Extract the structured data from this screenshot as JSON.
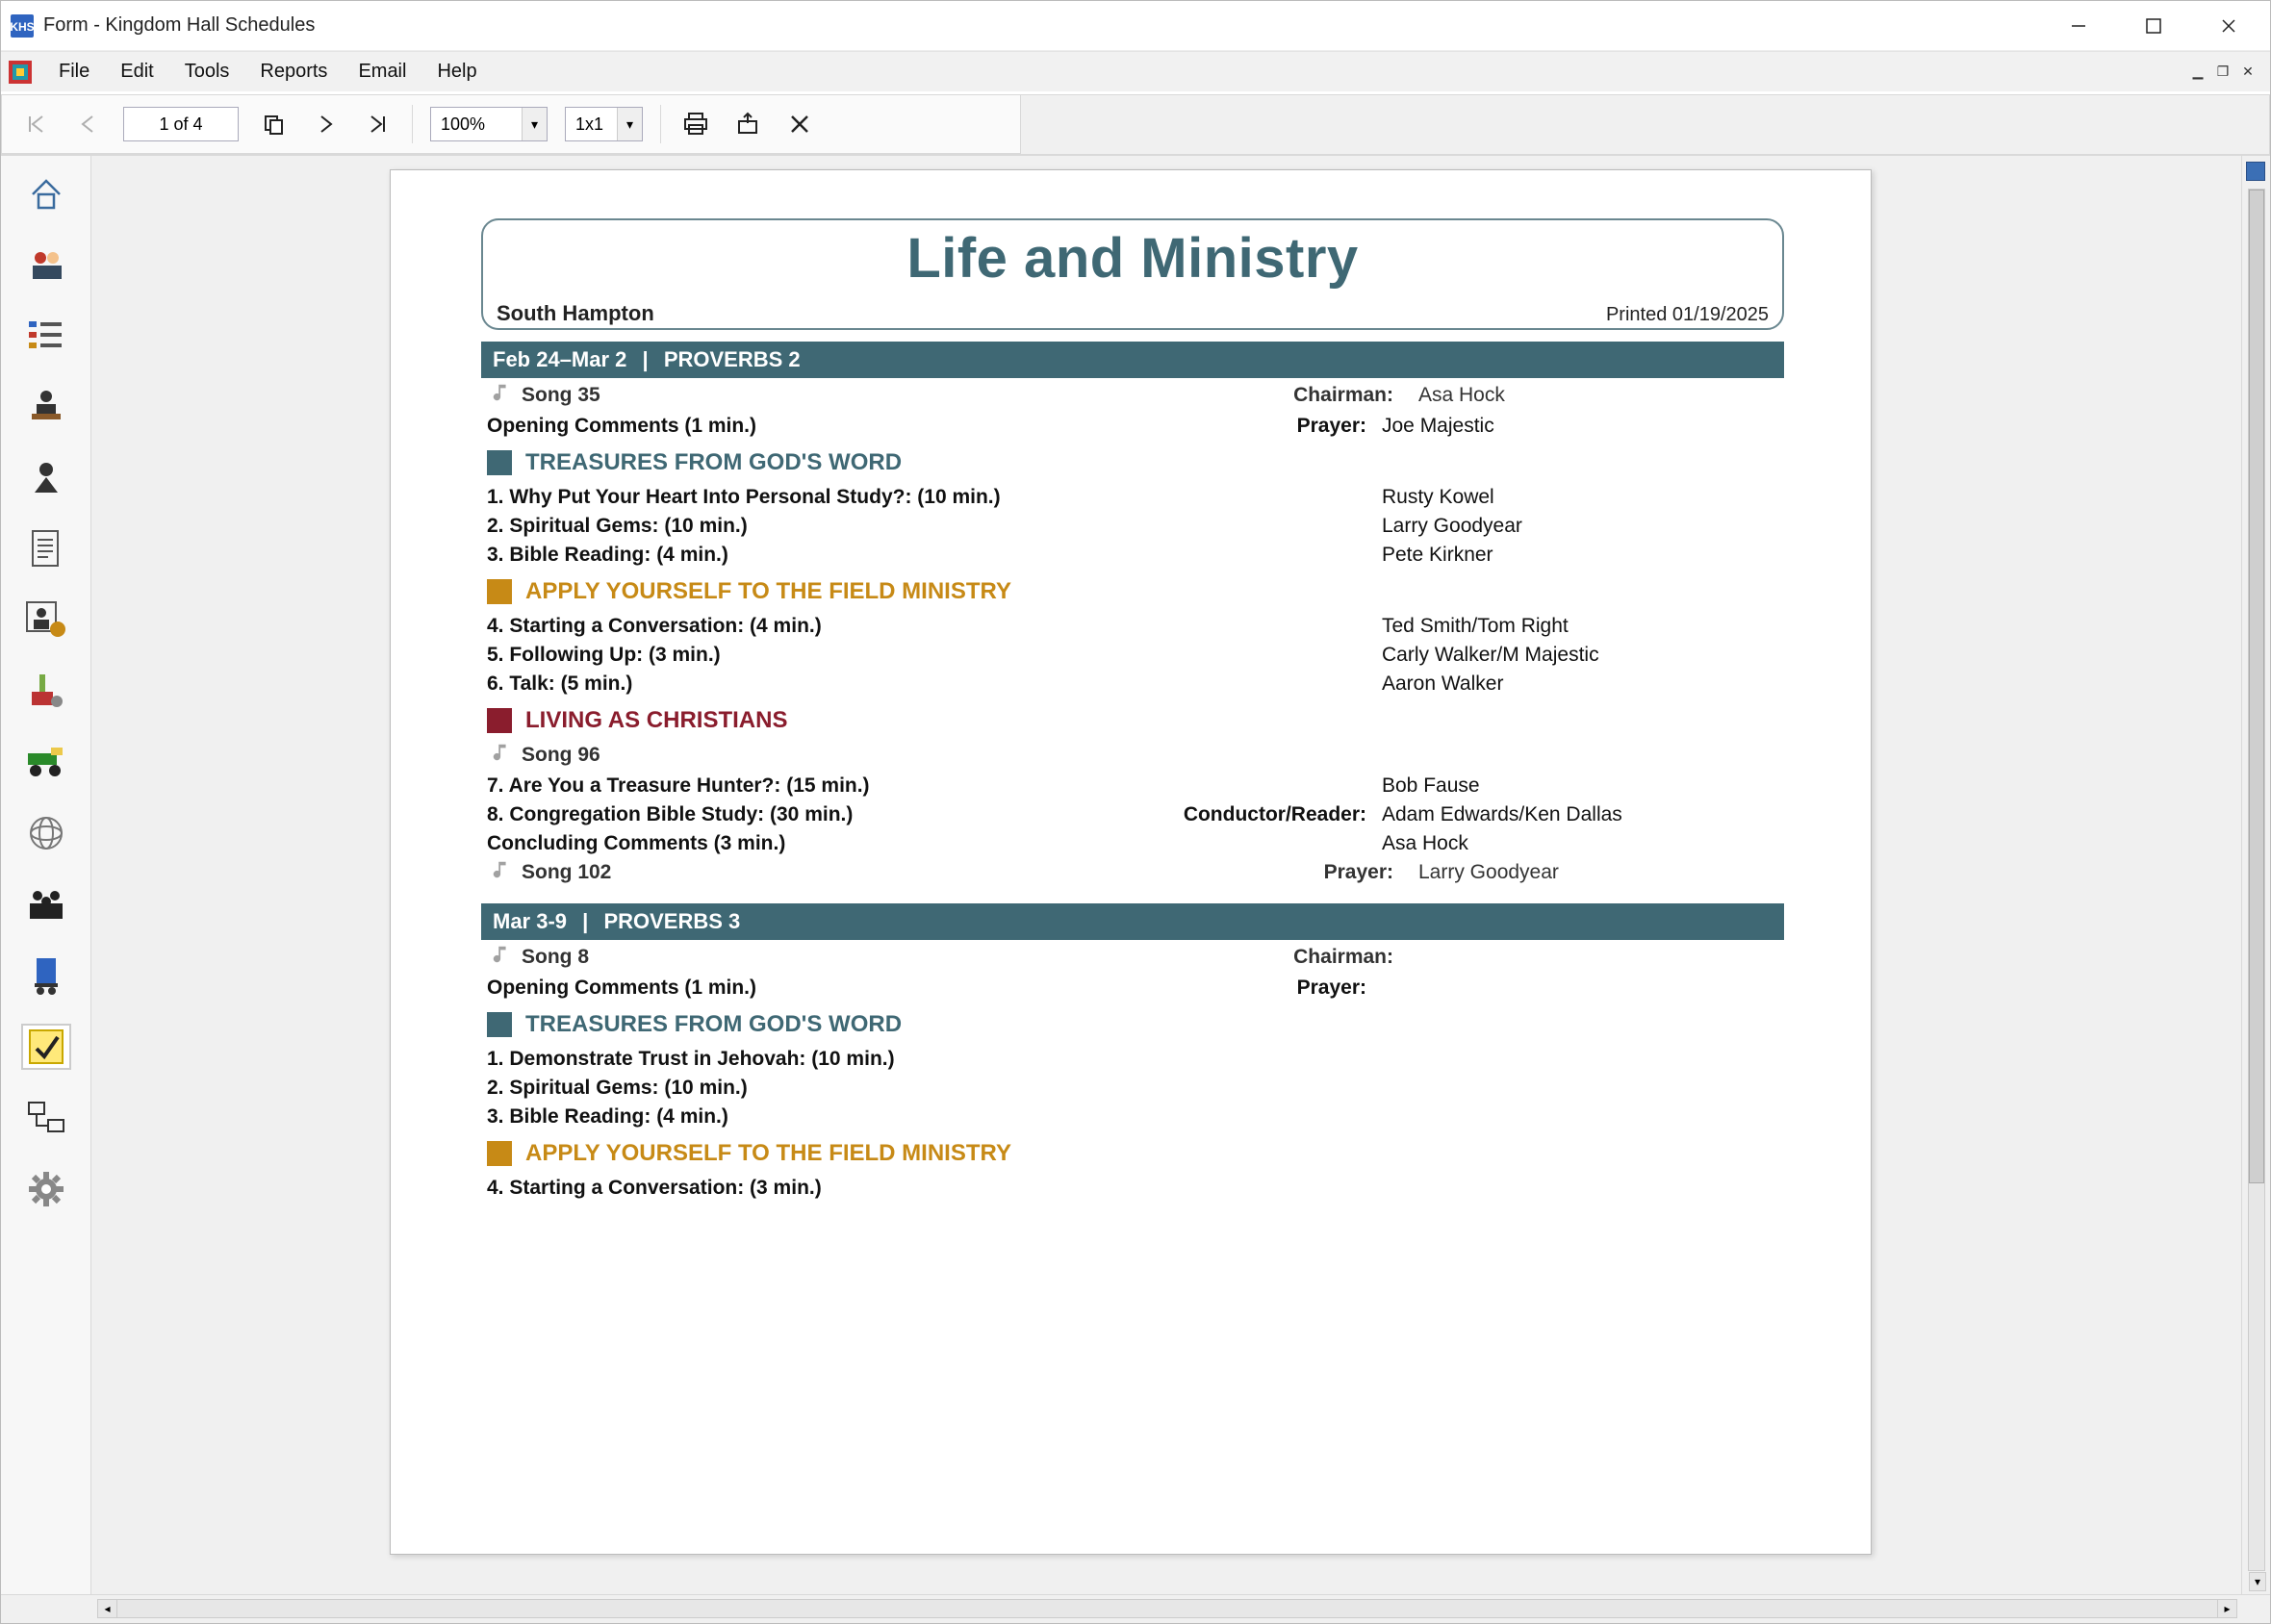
{
  "window": {
    "title": "Form - Kingdom Hall Schedules"
  },
  "menus": [
    "File",
    "Edit",
    "Tools",
    "Reports",
    "Email",
    "Help"
  ],
  "toolbar": {
    "page_display": "1 of 4",
    "zoom": "100%",
    "layout": "1x1"
  },
  "document": {
    "title": "Life and Ministry",
    "congregation": "South Hampton",
    "printed": "Printed 01/19/2025",
    "weeks": [
      {
        "dates": "Feb 24–Mar 2",
        "study": "PROVERBS 2",
        "open_song": "Song 35",
        "chairman_label": "Chairman:",
        "chairman": "Asa Hock",
        "opening_label": "Opening Comments (1 min.)",
        "prayer_label": "Prayer:",
        "prayer": "Joe Majestic",
        "treasures_head": "TREASURES FROM GOD'S WORD",
        "treasures": [
          {
            "t": "1. Why Put Your Heart Into Personal Study?: (10 min.)",
            "p": "Rusty Kowel"
          },
          {
            "t": "2. Spiritual Gems: (10 min.)",
            "p": "Larry Goodyear"
          },
          {
            "t": "3. Bible Reading: (4 min.)",
            "p": "Pete Kirkner"
          }
        ],
        "apply_head": "APPLY YOURSELF TO THE FIELD MINISTRY",
        "apply": [
          {
            "t": "4. Starting a Conversation: (4 min.)",
            "p": "Ted Smith/Tom Right"
          },
          {
            "t": "5. Following Up: (3 min.)",
            "p": "Carly Walker/M Majestic"
          },
          {
            "t": "6. Talk: (5 min.)",
            "p": "Aaron Walker"
          }
        ],
        "living_head": "LIVING AS CHRISTIANS",
        "mid_song": "Song 96",
        "living": [
          {
            "t": "7. Are You a Treasure Hunter?: (15 min.)",
            "l": "",
            "p": "Bob Fause"
          },
          {
            "t": "8. Congregation Bible Study: (30 min.)",
            "l": "Conductor/Reader:",
            "p": "Adam Edwards/Ken Dallas"
          }
        ],
        "concluding_label": "Concluding Comments (3 min.)",
        "concluding_person": "Asa Hock",
        "close_song": "Song 102",
        "close_prayer_label": "Prayer:",
        "close_prayer": "Larry Goodyear"
      },
      {
        "dates": "Mar 3-9",
        "study": "PROVERBS 3",
        "open_song": "Song 8",
        "chairman_label": "Chairman:",
        "chairman": "",
        "opening_label": "Opening Comments (1 min.)",
        "prayer_label": "Prayer:",
        "prayer": "",
        "treasures_head": "TREASURES FROM GOD'S WORD",
        "treasures": [
          {
            "t": "1. Demonstrate Trust in Jehovah: (10 min.)",
            "p": ""
          },
          {
            "t": "2. Spiritual Gems: (10 min.)",
            "p": ""
          },
          {
            "t": "3. Bible Reading: (4 min.)",
            "p": ""
          }
        ],
        "apply_head": "APPLY YOURSELF TO THE FIELD MINISTRY",
        "apply": [
          {
            "t": "4. Starting a Conversation: (3 min.)",
            "p": ""
          }
        ]
      }
    ]
  }
}
